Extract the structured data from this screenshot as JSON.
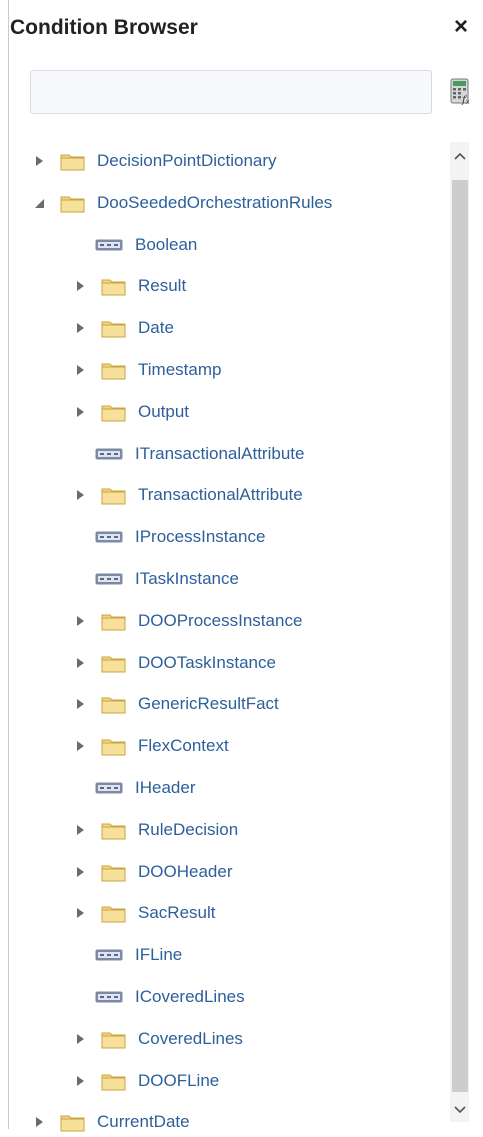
{
  "header": {
    "title": "Condition Browser",
    "close_glyph": "×"
  },
  "search": {
    "value": "",
    "placeholder": ""
  },
  "toolbar": {
    "calculator_icon": "expression-calculator-icon"
  },
  "tree": {
    "root1": {
      "label": "DecisionPointDictionary",
      "state": "collapsed"
    },
    "root2": {
      "label": "DooSeededOrchestrationRules",
      "state": "expanded",
      "children": [
        {
          "label": "Boolean",
          "type": "attribute"
        },
        {
          "label": "Result",
          "type": "folder"
        },
        {
          "label": "Date",
          "type": "folder"
        },
        {
          "label": "Timestamp",
          "type": "folder"
        },
        {
          "label": "Output",
          "type": "folder"
        },
        {
          "label": "ITransactionalAttribute",
          "type": "attribute"
        },
        {
          "label": "TransactionalAttribute",
          "type": "folder"
        },
        {
          "label": "IProcessInstance",
          "type": "attribute"
        },
        {
          "label": "ITaskInstance",
          "type": "attribute"
        },
        {
          "label": "DOOProcessInstance",
          "type": "folder"
        },
        {
          "label": "DOOTaskInstance",
          "type": "folder"
        },
        {
          "label": "GenericResultFact",
          "type": "folder"
        },
        {
          "label": "FlexContext",
          "type": "folder"
        },
        {
          "label": "IHeader",
          "type": "attribute"
        },
        {
          "label": "RuleDecision",
          "type": "folder"
        },
        {
          "label": "DOOHeader",
          "type": "folder"
        },
        {
          "label": "SacResult",
          "type": "folder"
        },
        {
          "label": "IFLine",
          "type": "attribute"
        },
        {
          "label": "ICoveredLines",
          "type": "attribute"
        },
        {
          "label": "CoveredLines",
          "type": "folder"
        },
        {
          "label": "DOOFLine",
          "type": "folder"
        }
      ]
    },
    "root3": {
      "label": "CurrentDate",
      "state": "collapsed"
    }
  },
  "colors": {
    "link": "#2d5f9a",
    "folder": "#f3d57c",
    "folder_edge": "#c9a542",
    "attr_badge": "#7d8aa6"
  }
}
